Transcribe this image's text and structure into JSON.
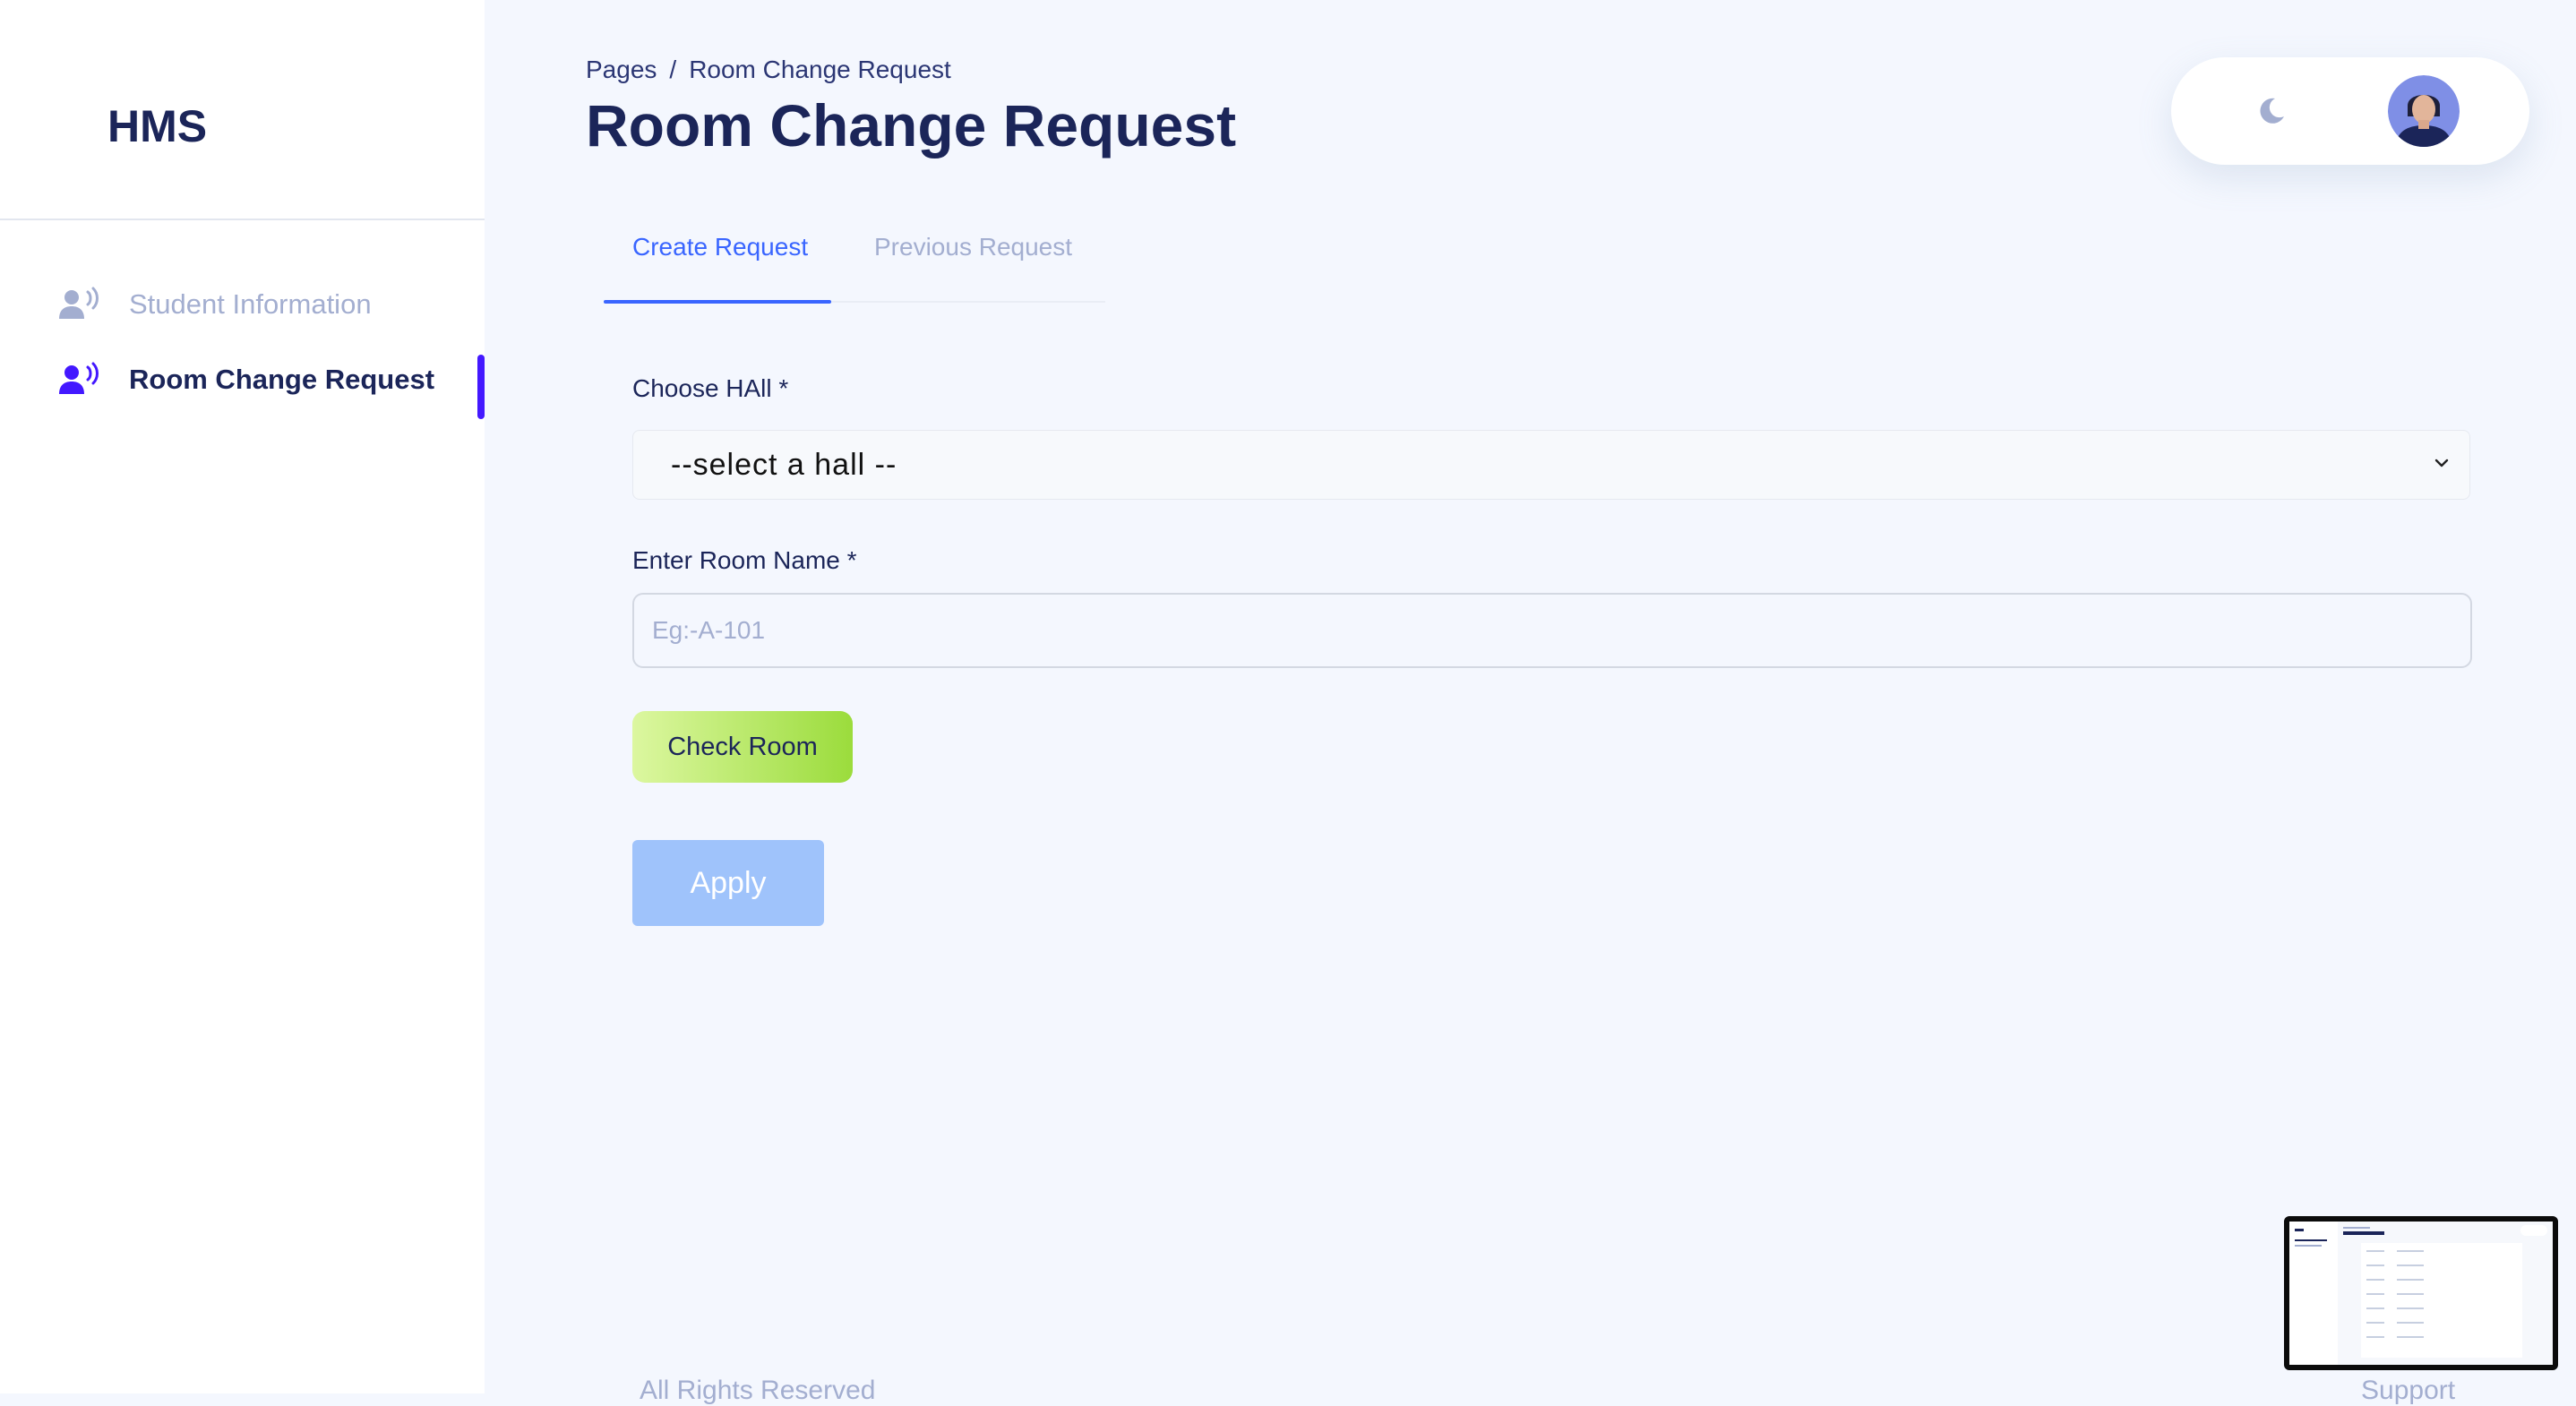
{
  "sidebar": {
    "brand": "HMS",
    "items": [
      {
        "label": "Student Information",
        "icon": "users-icon",
        "active": false
      },
      {
        "label": "Room Change Request",
        "icon": "users-icon",
        "active": true
      }
    ]
  },
  "header": {
    "breadcrumb": {
      "root": "Pages",
      "separator": "/",
      "current": "Room Change Request"
    },
    "title": "Room Change Request",
    "icons": {
      "theme": "moon-icon",
      "profile": "avatar"
    }
  },
  "tabs": [
    {
      "label": "Create Request",
      "active": true
    },
    {
      "label": "Previous Request",
      "active": false
    }
  ],
  "form": {
    "hall_label": "Choose HAll *",
    "hall_selected": "--select a hall --",
    "room_label": "Enter Room Name *",
    "room_placeholder": "Eg:-A-101",
    "room_value": "",
    "check_button": "Check Room",
    "apply_button": "Apply"
  },
  "footer": {
    "left": "All Rights Reserved",
    "right": "Support"
  },
  "colors": {
    "accent": "#4318ff",
    "tab_active": "#3965ff",
    "check_button_gradient_start": "#dcf7a0",
    "check_button_gradient_end": "#9bdc3c",
    "apply_button": "#9fc3fb"
  }
}
